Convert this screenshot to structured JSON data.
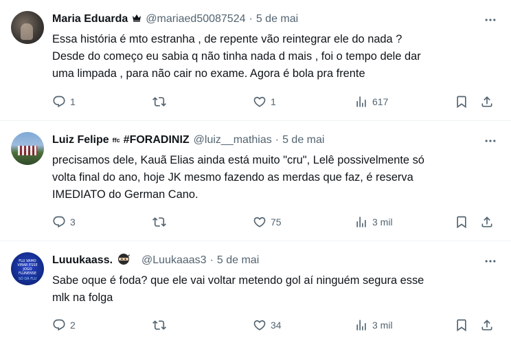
{
  "tweets": [
    {
      "name": "Maria Eduarda",
      "handle": "@mariaed50087524",
      "date": "5 de mai",
      "lines": [
        "Essa história é mto estranha , de repente vão reintegrar ele do nada ?",
        "Desde do começo eu sabia q não tinha nada d mais , foi o tempo dele dar",
        "uma limpada , para não cair no exame. Agora é bola pra frente"
      ],
      "replies": "1",
      "retweets": "",
      "likes": "1",
      "views": "617"
    },
    {
      "name": "Luiz Felipe",
      "name_suffix": "ffc",
      "name_tag": "#FORADINIZ",
      "handle": "@luiz__mathias",
      "date": "5 de mai",
      "lines": [
        "precisamos dele, Kauã Elias ainda está muito \"cru\", Lelê possivelmente só",
        "volta final do ano, hoje JK mesmo fazendo as merdas que faz, é reserva",
        "IMEDIATO do German Cano."
      ],
      "replies": "3",
      "retweets": "",
      "likes": "75",
      "views": "3 mil"
    },
    {
      "name": "Luuukaass.",
      "handle": "@Luukaaas3",
      "date": "5 de mai",
      "avatar_text": "FLU VAMO VIRAR ESSE JOGO FLUNENSE",
      "avatar_text2": "SÓ DÁ FLU",
      "lines": [
        "Sabe oque é foda? que ele vai voltar metendo gol aí ninguém segura esse",
        "mlk na folga"
      ],
      "replies": "2",
      "retweets": "",
      "likes": "34",
      "views": "3 mil"
    }
  ],
  "icons": {
    "reply": "reply-icon",
    "retweet": "retweet-icon",
    "like": "heart-icon",
    "views": "views-icon",
    "bookmark": "bookmark-icon",
    "share": "share-icon",
    "more": "more-icon",
    "crown": "crown-icon",
    "ninja": "ninja-emoji-icon"
  },
  "colors": {
    "text_primary": "#0f1419",
    "text_secondary": "#536471",
    "divider": "#eff3f4",
    "background": "#ffffff"
  }
}
